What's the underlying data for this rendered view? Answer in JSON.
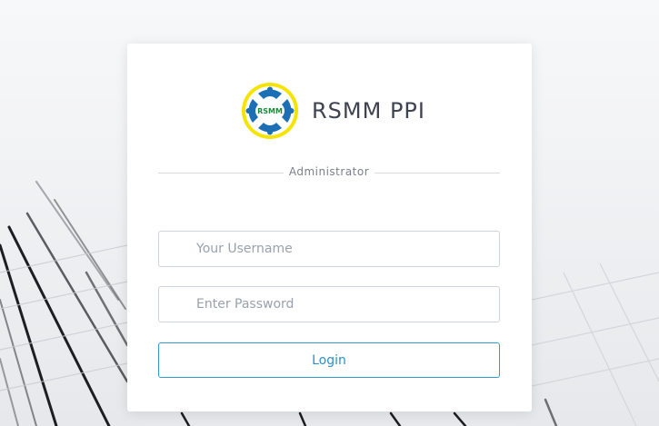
{
  "brand": {
    "logo_text": "RSMM",
    "name": "RSMM PPI"
  },
  "divider_label": "Administrator",
  "form": {
    "username_placeholder": "Your Username",
    "username_value": "",
    "password_placeholder": "Enter Password",
    "password_value": "",
    "login_label": "Login"
  },
  "colors": {
    "accent": "#2f9bd0",
    "logo_ring": "#f5e400",
    "logo_blue": "#1c6fb5",
    "logo_text": "#1a8a3a"
  }
}
